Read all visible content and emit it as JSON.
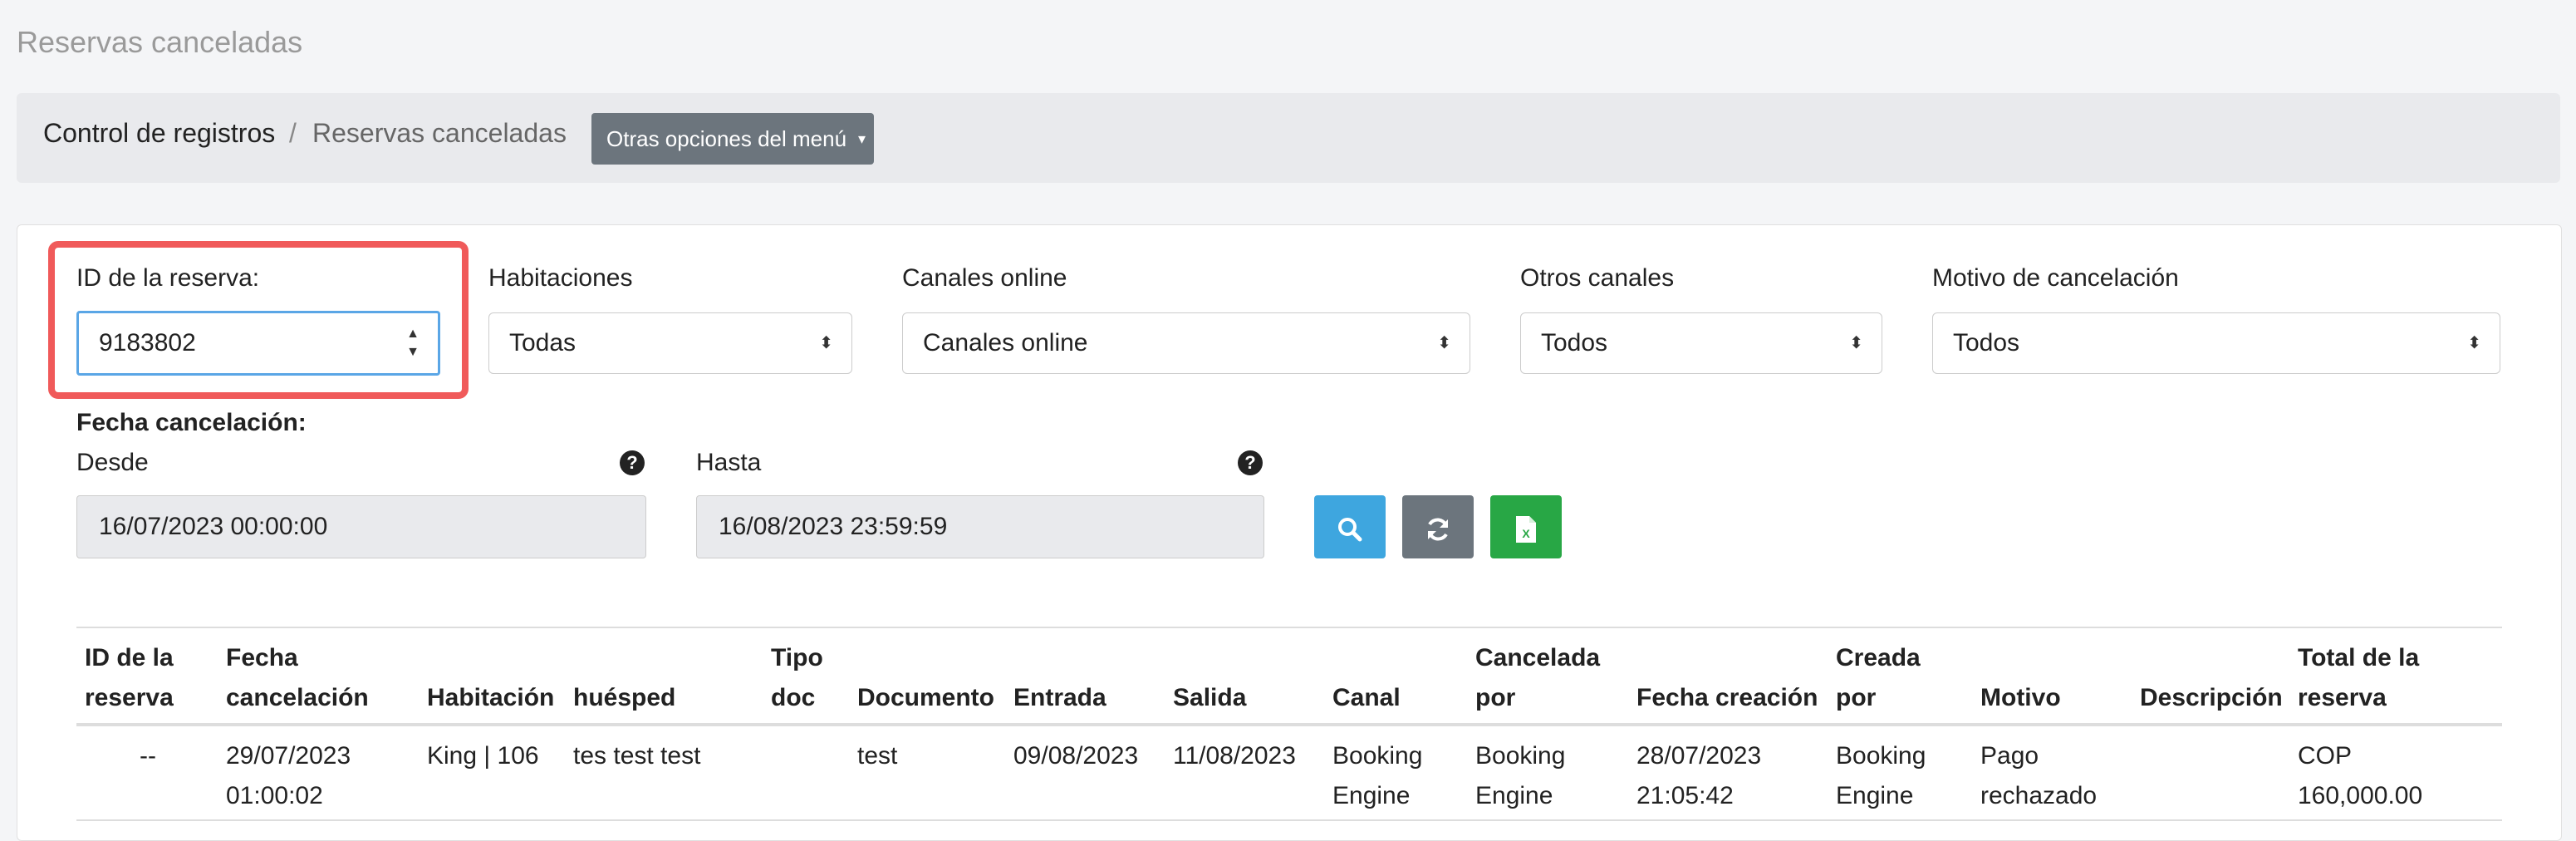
{
  "page": {
    "title": "Reservas canceladas"
  },
  "breadcrumb": {
    "home": "Control de registros",
    "separator": "/",
    "current": "Reservas canceladas",
    "menu_button": "Otras opciones del menú"
  },
  "filters": {
    "reservation_id": {
      "label": "ID de la reserva:",
      "value": "9183802"
    },
    "rooms": {
      "label": "Habitaciones",
      "value": "Todas"
    },
    "online_channels": {
      "label": "Canales online",
      "value": "Canales online"
    },
    "other_channels": {
      "label": "Otros canales",
      "value": "Todos"
    },
    "cancel_reason": {
      "label": "Motivo de cancelación",
      "value": "Todos"
    },
    "cancel_date_label": "Fecha cancelación:",
    "from": {
      "label": "Desde",
      "value": "16/07/2023 00:00:00"
    },
    "to": {
      "label": "Hasta",
      "value": "16/08/2023 23:59:59"
    }
  },
  "actions": {
    "search_icon": "search-icon",
    "refresh_icon": "refresh-icon",
    "excel_icon": "excel-icon"
  },
  "colors": {
    "search": "#3ea6df",
    "refresh": "#6c757d",
    "excel": "#28a745",
    "highlight": "#f05a5a"
  },
  "table": {
    "headers": [
      [
        "ID de la",
        "reserva"
      ],
      [
        "Fecha",
        "cancelación"
      ],
      [
        "",
        "Habitación"
      ],
      [
        "",
        "huésped"
      ],
      [
        "Tipo",
        "doc"
      ],
      [
        "",
        "Documento"
      ],
      [
        "",
        "Entrada"
      ],
      [
        "",
        "Salida"
      ],
      [
        "",
        "Canal"
      ],
      [
        "Cancelada",
        "por"
      ],
      [
        "",
        "Fecha creación"
      ],
      [
        "Creada",
        "por"
      ],
      [
        "",
        "Motivo"
      ],
      [
        "",
        "Descripción"
      ],
      [
        "Total de la",
        "reserva"
      ]
    ],
    "rows": [
      [
        [
          "--",
          ""
        ],
        [
          "29/07/2023",
          "01:00:02"
        ],
        [
          "King | 106",
          ""
        ],
        [
          "tes test test",
          ""
        ],
        [
          "",
          ""
        ],
        [
          "test",
          ""
        ],
        [
          "09/08/2023",
          ""
        ],
        [
          "11/08/2023",
          ""
        ],
        [
          "Booking",
          "Engine"
        ],
        [
          "Booking",
          "Engine"
        ],
        [
          "28/07/2023",
          "21:05:42"
        ],
        [
          "Booking",
          "Engine"
        ],
        [
          "Pago",
          "rechazado"
        ],
        [
          "",
          ""
        ],
        [
          "COP",
          "160,000.00"
        ]
      ]
    ]
  }
}
